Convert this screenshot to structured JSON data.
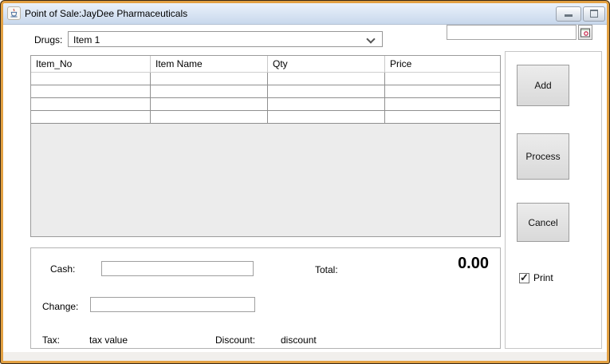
{
  "window": {
    "title": "Point of Sale:JayDee Pharmaceuticals"
  },
  "toolbar": {
    "drugs_label": "Drugs:",
    "drugs_selected": "Item 1",
    "scan_value": ""
  },
  "table": {
    "columns": [
      "Item_No",
      "Item Name",
      "Qty",
      "Price"
    ],
    "rows": [
      [
        "",
        "",
        "",
        ""
      ],
      [
        "",
        "",
        "",
        ""
      ],
      [
        "",
        "",
        "",
        ""
      ],
      [
        "",
        "",
        "",
        ""
      ]
    ]
  },
  "actions": {
    "add": "Add",
    "process": "Process",
    "cancel": "Cancel",
    "print_label": "Print",
    "print_checked": true
  },
  "payment": {
    "cash_label": "Cash:",
    "cash_value": "",
    "total_label": "Total:",
    "total_value": "0.00",
    "change_label": "Change:",
    "change_value": "",
    "tax_label": "Tax:",
    "tax_value": "tax value",
    "discount_label": "Discount:",
    "discount_value": "discount"
  },
  "colors": {
    "frame_dark": "#3a2b18",
    "frame_orange": "#e3a143",
    "titlebar_top": "#eaf2fb",
    "titlebar_bottom": "#c8d8ec",
    "table_empty": "#ececec",
    "button_top": "#ececec",
    "button_bottom": "#d9d9d9",
    "lookup_icon_red": "#cc3355"
  }
}
